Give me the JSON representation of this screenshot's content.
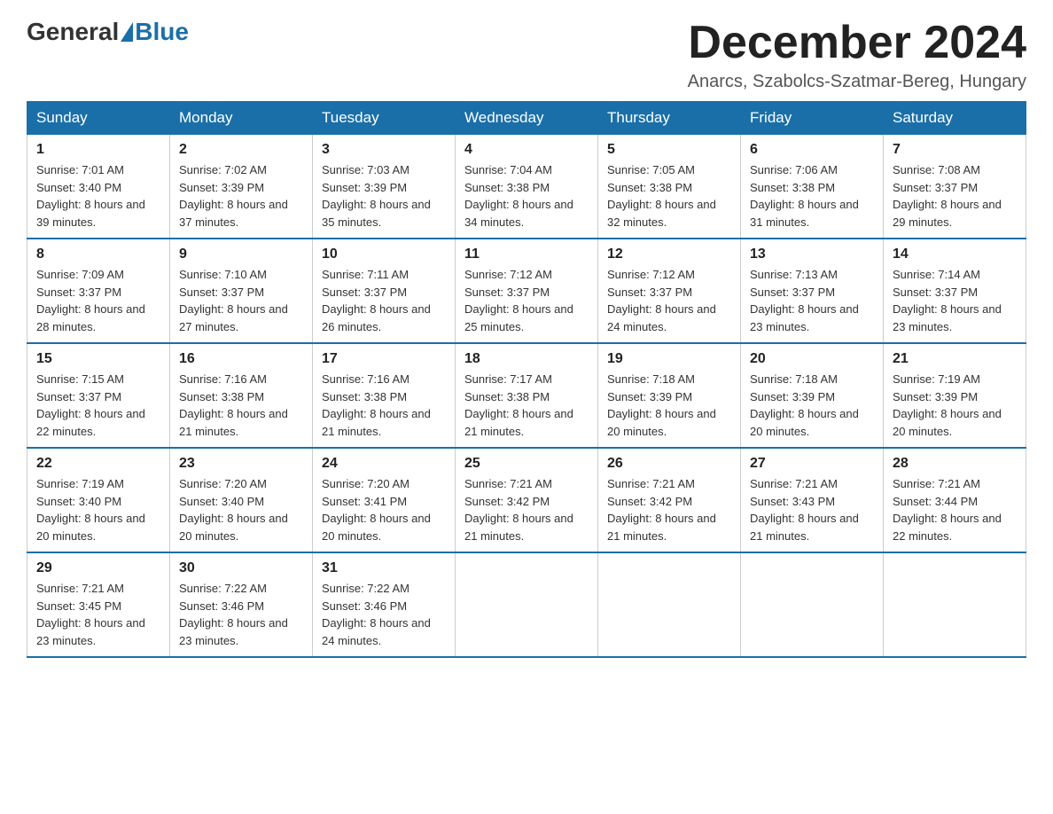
{
  "header": {
    "logo_general": "General",
    "logo_blue": "Blue",
    "month_title": "December 2024",
    "location": "Anarcs, Szabolcs-Szatmar-Bereg, Hungary"
  },
  "days_of_week": [
    "Sunday",
    "Monday",
    "Tuesday",
    "Wednesday",
    "Thursday",
    "Friday",
    "Saturday"
  ],
  "weeks": [
    [
      {
        "day": "1",
        "sunrise": "7:01 AM",
        "sunset": "3:40 PM",
        "daylight": "8 hours and 39 minutes."
      },
      {
        "day": "2",
        "sunrise": "7:02 AM",
        "sunset": "3:39 PM",
        "daylight": "8 hours and 37 minutes."
      },
      {
        "day": "3",
        "sunrise": "7:03 AM",
        "sunset": "3:39 PM",
        "daylight": "8 hours and 35 minutes."
      },
      {
        "day": "4",
        "sunrise": "7:04 AM",
        "sunset": "3:38 PM",
        "daylight": "8 hours and 34 minutes."
      },
      {
        "day": "5",
        "sunrise": "7:05 AM",
        "sunset": "3:38 PM",
        "daylight": "8 hours and 32 minutes."
      },
      {
        "day": "6",
        "sunrise": "7:06 AM",
        "sunset": "3:38 PM",
        "daylight": "8 hours and 31 minutes."
      },
      {
        "day": "7",
        "sunrise": "7:08 AM",
        "sunset": "3:37 PM",
        "daylight": "8 hours and 29 minutes."
      }
    ],
    [
      {
        "day": "8",
        "sunrise": "7:09 AM",
        "sunset": "3:37 PM",
        "daylight": "8 hours and 28 minutes."
      },
      {
        "day": "9",
        "sunrise": "7:10 AM",
        "sunset": "3:37 PM",
        "daylight": "8 hours and 27 minutes."
      },
      {
        "day": "10",
        "sunrise": "7:11 AM",
        "sunset": "3:37 PM",
        "daylight": "8 hours and 26 minutes."
      },
      {
        "day": "11",
        "sunrise": "7:12 AM",
        "sunset": "3:37 PM",
        "daylight": "8 hours and 25 minutes."
      },
      {
        "day": "12",
        "sunrise": "7:12 AM",
        "sunset": "3:37 PM",
        "daylight": "8 hours and 24 minutes."
      },
      {
        "day": "13",
        "sunrise": "7:13 AM",
        "sunset": "3:37 PM",
        "daylight": "8 hours and 23 minutes."
      },
      {
        "day": "14",
        "sunrise": "7:14 AM",
        "sunset": "3:37 PM",
        "daylight": "8 hours and 23 minutes."
      }
    ],
    [
      {
        "day": "15",
        "sunrise": "7:15 AM",
        "sunset": "3:37 PM",
        "daylight": "8 hours and 22 minutes."
      },
      {
        "day": "16",
        "sunrise": "7:16 AM",
        "sunset": "3:38 PM",
        "daylight": "8 hours and 21 minutes."
      },
      {
        "day": "17",
        "sunrise": "7:16 AM",
        "sunset": "3:38 PM",
        "daylight": "8 hours and 21 minutes."
      },
      {
        "day": "18",
        "sunrise": "7:17 AM",
        "sunset": "3:38 PM",
        "daylight": "8 hours and 21 minutes."
      },
      {
        "day": "19",
        "sunrise": "7:18 AM",
        "sunset": "3:39 PM",
        "daylight": "8 hours and 20 minutes."
      },
      {
        "day": "20",
        "sunrise": "7:18 AM",
        "sunset": "3:39 PM",
        "daylight": "8 hours and 20 minutes."
      },
      {
        "day": "21",
        "sunrise": "7:19 AM",
        "sunset": "3:39 PM",
        "daylight": "8 hours and 20 minutes."
      }
    ],
    [
      {
        "day": "22",
        "sunrise": "7:19 AM",
        "sunset": "3:40 PM",
        "daylight": "8 hours and 20 minutes."
      },
      {
        "day": "23",
        "sunrise": "7:20 AM",
        "sunset": "3:40 PM",
        "daylight": "8 hours and 20 minutes."
      },
      {
        "day": "24",
        "sunrise": "7:20 AM",
        "sunset": "3:41 PM",
        "daylight": "8 hours and 20 minutes."
      },
      {
        "day": "25",
        "sunrise": "7:21 AM",
        "sunset": "3:42 PM",
        "daylight": "8 hours and 21 minutes."
      },
      {
        "day": "26",
        "sunrise": "7:21 AM",
        "sunset": "3:42 PM",
        "daylight": "8 hours and 21 minutes."
      },
      {
        "day": "27",
        "sunrise": "7:21 AM",
        "sunset": "3:43 PM",
        "daylight": "8 hours and 21 minutes."
      },
      {
        "day": "28",
        "sunrise": "7:21 AM",
        "sunset": "3:44 PM",
        "daylight": "8 hours and 22 minutes."
      }
    ],
    [
      {
        "day": "29",
        "sunrise": "7:21 AM",
        "sunset": "3:45 PM",
        "daylight": "8 hours and 23 minutes."
      },
      {
        "day": "30",
        "sunrise": "7:22 AM",
        "sunset": "3:46 PM",
        "daylight": "8 hours and 23 minutes."
      },
      {
        "day": "31",
        "sunrise": "7:22 AM",
        "sunset": "3:46 PM",
        "daylight": "8 hours and 24 minutes."
      },
      null,
      null,
      null,
      null
    ]
  ]
}
